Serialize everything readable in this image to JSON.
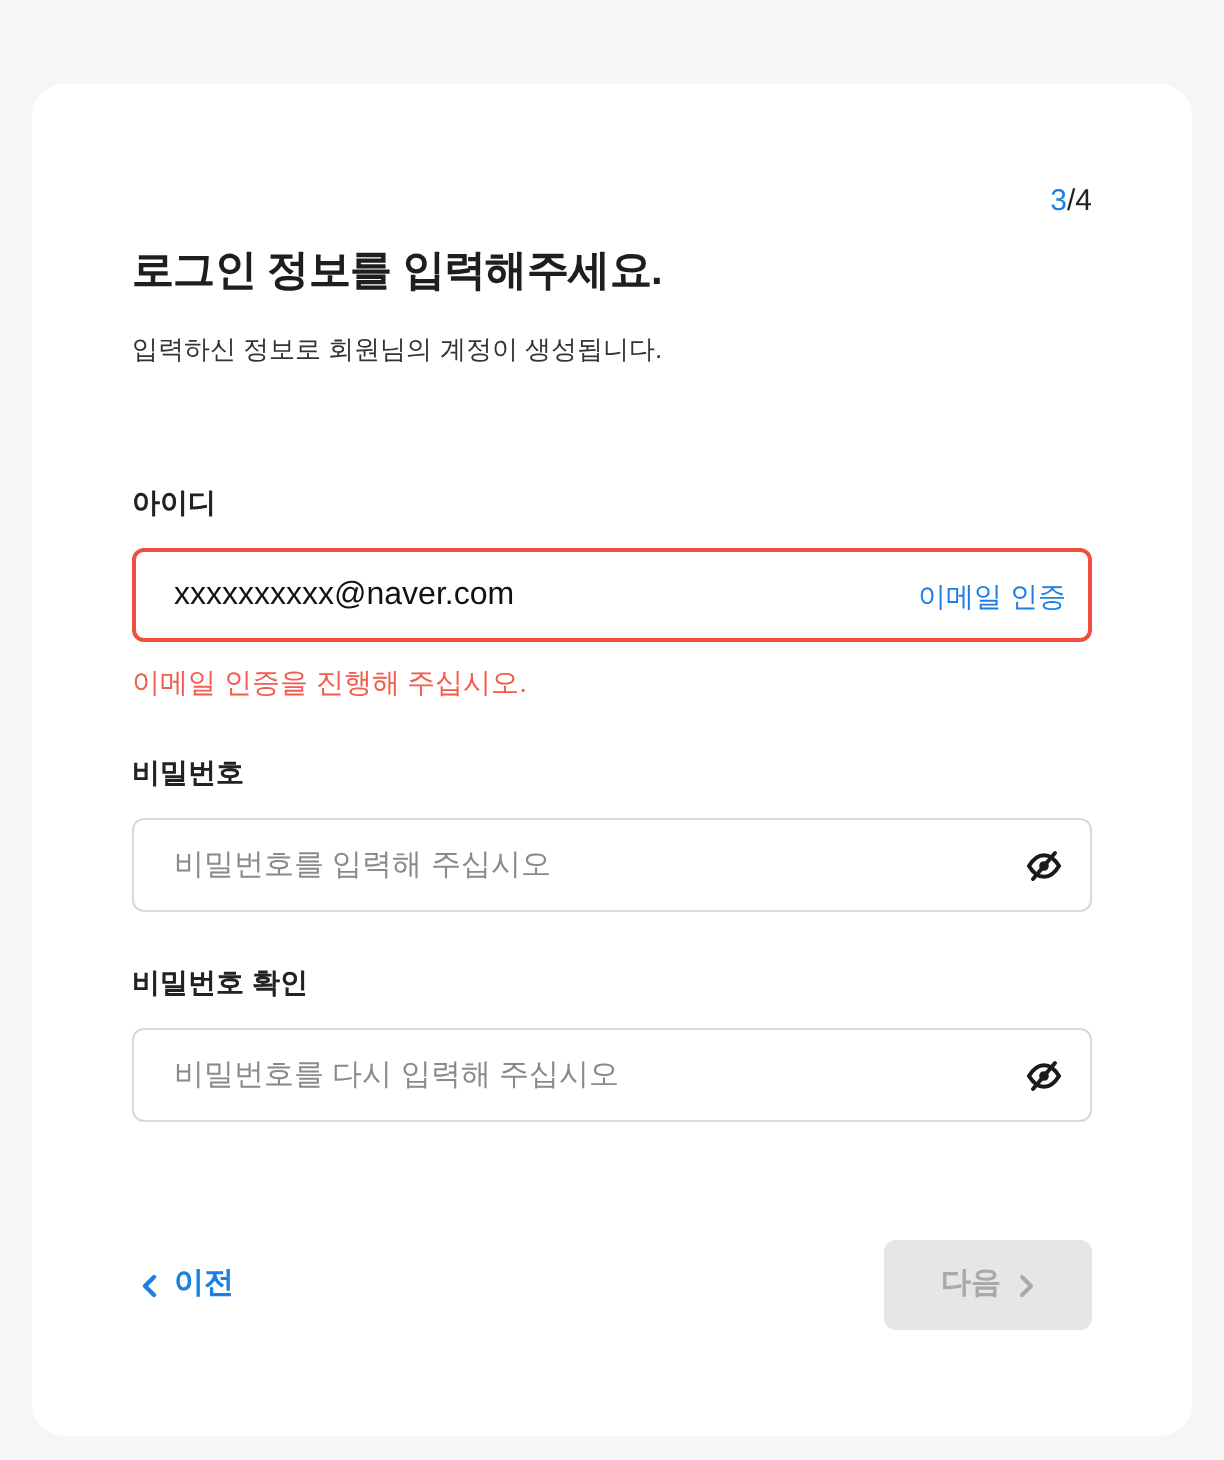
{
  "step": {
    "current": "3",
    "separator": "/",
    "total": "4"
  },
  "title": "로그인 정보를 입력해주세요.",
  "subtitle": "입력하신 정보로 회원님의 계정이 생성됩니다.",
  "fields": [
    {
      "kind": "email",
      "label": "아이디",
      "value": "xxxxxxxxxx@naver.com",
      "action": "이메일 인증",
      "invalid": true,
      "error": "이메일 인증을 진행해 주십시오."
    },
    {
      "kind": "password",
      "label": "비밀번호",
      "placeholder": "비밀번호를 입력해 주십시오",
      "invalid": false
    },
    {
      "kind": "password",
      "label": "비밀번호 확인",
      "placeholder": "비밀번호를 다시 입력해 주십시오",
      "invalid": false
    }
  ],
  "footer": {
    "back": {
      "label": "이전"
    },
    "next": {
      "label": "다음",
      "disabled": true
    }
  }
}
